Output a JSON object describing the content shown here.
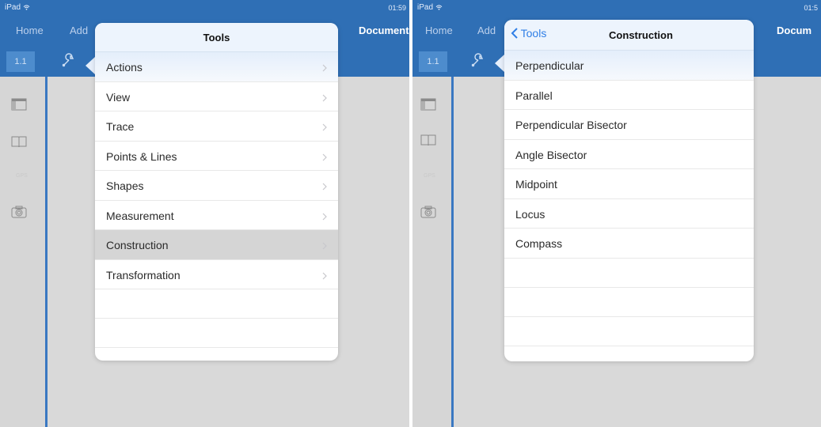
{
  "left_screen": {
    "status": {
      "carrier": "iPad",
      "time": "01:59"
    },
    "nav": {
      "home": "Home",
      "add": "Add",
      "document": "Document"
    },
    "page_tab": "1.1",
    "popover": {
      "title": "Tools",
      "items": [
        {
          "label": "Actions"
        },
        {
          "label": "View"
        },
        {
          "label": "Trace"
        },
        {
          "label": "Points & Lines"
        },
        {
          "label": "Shapes"
        },
        {
          "label": "Measurement"
        },
        {
          "label": "Construction",
          "selected": true
        },
        {
          "label": "Transformation"
        }
      ]
    }
  },
  "right_screen": {
    "status": {
      "carrier": "iPad",
      "time": "01:5"
    },
    "nav": {
      "home": "Home",
      "add": "Add",
      "document": "Docum"
    },
    "page_tab": "1.1",
    "popover": {
      "back_label": "Tools",
      "title": "Construction",
      "items": [
        {
          "label": "Perpendicular"
        },
        {
          "label": "Parallel"
        },
        {
          "label": "Perpendicular Bisector"
        },
        {
          "label": "Angle Bisector"
        },
        {
          "label": "Midpoint"
        },
        {
          "label": "Locus"
        },
        {
          "label": "Compass"
        }
      ]
    }
  },
  "sidebar_icons": [
    "page-sorter-icon",
    "book-icon",
    "gps-icon",
    "camera-icon"
  ],
  "colors": {
    "accent": "#2f6fb5",
    "link": "#2f7ee6",
    "background": "#d9d9d9",
    "selected_row": "#d5d5d5"
  }
}
